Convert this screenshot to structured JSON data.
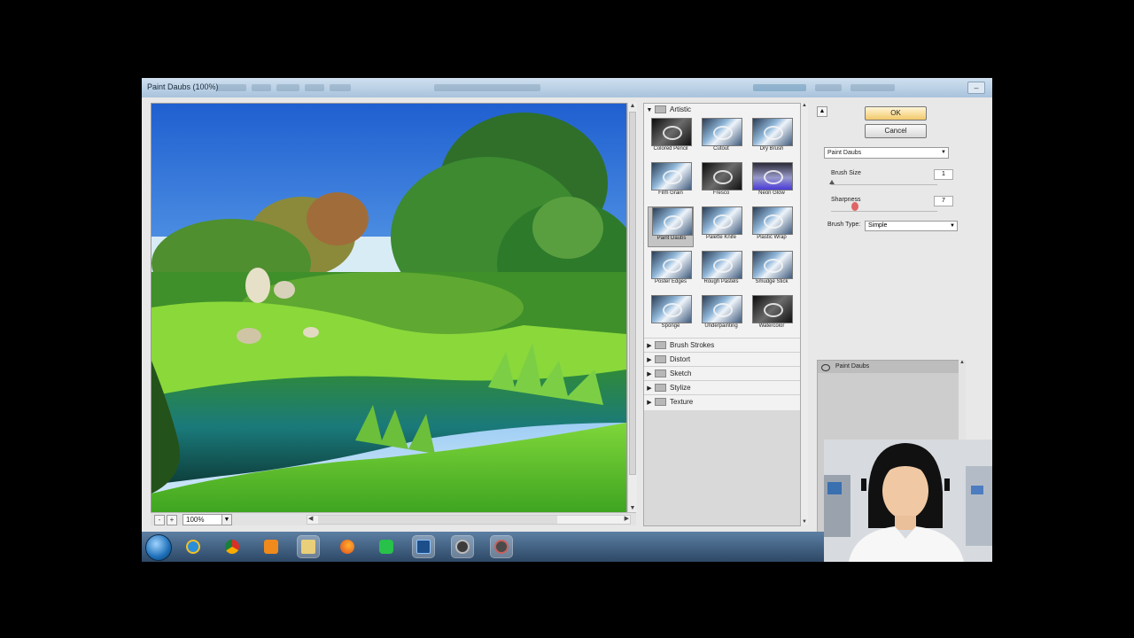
{
  "window": {
    "title": "Paint Daubs (100%)"
  },
  "preview": {
    "zoom": "100%",
    "zoom_out": "-",
    "zoom_in": "+"
  },
  "gallery": {
    "open_category": "Artistic",
    "filters": [
      "Colored Pencil",
      "Cutout",
      "Dry Brush",
      "Film Grain",
      "Fresco",
      "Neon Glow",
      "Paint Daubs",
      "Palette Knife",
      "Plastic Wrap",
      "Poster Edges",
      "Rough Pastels",
      "Smudge Stick",
      "Sponge",
      "Underpainting",
      "Watercolor"
    ],
    "selected_filter": "Paint Daubs",
    "categories": [
      "Brush Strokes",
      "Distort",
      "Sketch",
      "Stylize",
      "Texture"
    ]
  },
  "settings": {
    "ok_label": "OK",
    "cancel_label": "Cancel",
    "filter": "Paint Daubs",
    "brush_size_label": "Brush Size",
    "brush_size": "1",
    "sharpness_label": "Sharpness",
    "sharpness": "7",
    "brush_type_label": "Brush Type:",
    "brush_type": "Simple"
  },
  "layers": {
    "items": [
      "Paint Daubs"
    ]
  },
  "taskbar": {
    "apps": [
      "internet-explorer",
      "chrome",
      "media-player",
      "file-explorer",
      "firefox",
      "line",
      "photoshop",
      "app-8",
      "app-9"
    ],
    "active_app": "photoshop"
  }
}
